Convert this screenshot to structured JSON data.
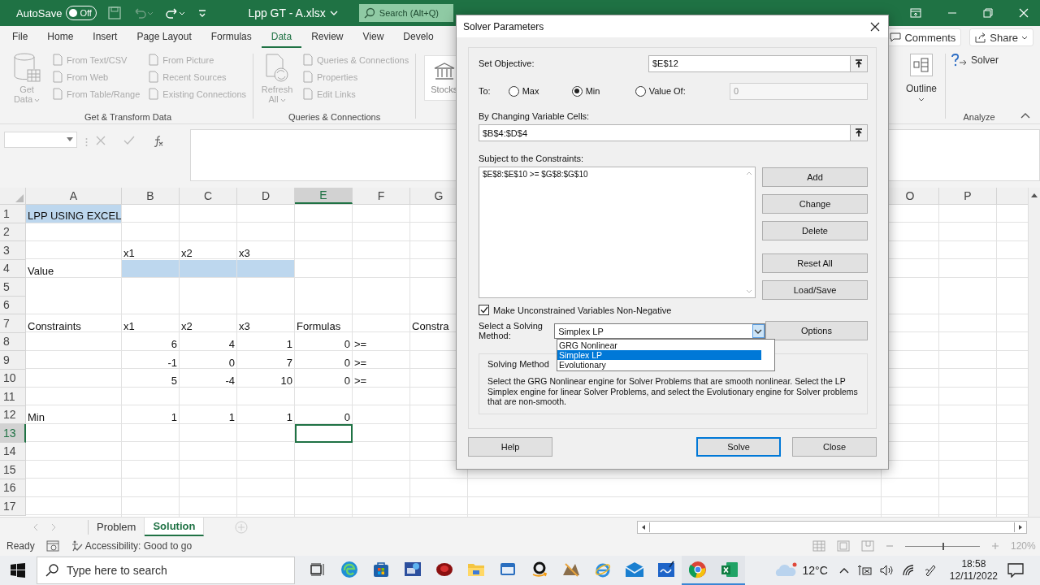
{
  "title_bar": {
    "autosave": {
      "label": "AutoSave",
      "state": "Off",
      "on": false
    },
    "document_title": "Lpp GT - A.xlsx",
    "search": {
      "placeholder": "Search (Alt+Q)"
    }
  },
  "ribbon_tabs": [
    {
      "label": "File",
      "selected": false
    },
    {
      "label": "Home",
      "selected": false
    },
    {
      "label": "Insert",
      "selected": false
    },
    {
      "label": "Page Layout",
      "selected": false
    },
    {
      "label": "Formulas",
      "selected": false
    },
    {
      "label": "Data",
      "selected": true
    },
    {
      "label": "Review",
      "selected": false
    },
    {
      "label": "View",
      "selected": false
    },
    {
      "label": "Develo",
      "selected": false
    }
  ],
  "comments_button": "Comments",
  "share_button": "Share",
  "ribbon_groups": [
    {
      "name": "Get & Transform Data",
      "large_button": {
        "label": "Get Data",
        "kind": "database",
        "disabled": true
      },
      "columns": [
        [
          {
            "label": "From Text/CSV",
            "disabled": true
          },
          {
            "label": "From Web",
            "disabled": true
          },
          {
            "label": "From Table/Range",
            "disabled": true
          }
        ],
        [
          {
            "label": "From Picture",
            "disabled": true
          },
          {
            "label": "Recent Sources",
            "disabled": true
          },
          {
            "label": "Existing Connections",
            "disabled": true
          }
        ]
      ]
    },
    {
      "name": "Queries & Connections",
      "large_button": {
        "label": "Refresh All",
        "kind": "refresh",
        "disabled": true
      },
      "columns": [
        [
          {
            "label": "Queries & Connections",
            "disabled": true
          },
          {
            "label": "Properties",
            "disabled": true
          },
          {
            "label": "Edit Links",
            "disabled": true
          }
        ]
      ]
    }
  ],
  "data_types": {
    "label": "Stocks"
  },
  "outline": {
    "label": "Outline"
  },
  "analyze": {
    "name": "Analyze",
    "solver": "Solver"
  },
  "grid": {
    "columns": [
      {
        "label": "A",
        "selected": false
      },
      {
        "label": "B",
        "selected": false
      },
      {
        "label": "C",
        "selected": false
      },
      {
        "label": "D",
        "selected": false
      },
      {
        "label": "E",
        "selected": true
      },
      {
        "label": "F",
        "selected": false
      },
      {
        "label": "G",
        "selected": false
      },
      {
        "label": "O",
        "selected": false
      },
      {
        "label": "P",
        "selected": false
      }
    ],
    "rows": [
      {
        "number": "1",
        "selected": false,
        "cells": [
          {
            "text": "LPP USING EXCEL",
            "highlighted": true
          }
        ]
      },
      {
        "number": "2",
        "selected": false
      },
      {
        "number": "3",
        "selected": false,
        "cells": [
          null,
          {
            "text": "x1"
          },
          {
            "text": "x2"
          },
          {
            "text": "x3"
          }
        ]
      },
      {
        "number": "4",
        "selected": false,
        "cells": [
          {
            "text": "Value"
          },
          {
            "highlighted": true
          },
          {
            "highlighted": true
          },
          {
            "highlighted": true
          }
        ]
      },
      {
        "number": "5",
        "selected": false
      },
      {
        "number": "6",
        "selected": false
      },
      {
        "number": "7",
        "selected": false,
        "cells": [
          {
            "text": "Constraints"
          },
          {
            "text": "x1"
          },
          {
            "text": "x2"
          },
          {
            "text": "x3"
          },
          {
            "text": "Formulas"
          },
          null,
          {
            "text": "Constra"
          }
        ]
      },
      {
        "number": "8",
        "selected": false,
        "cells": [
          null,
          {
            "text": "6",
            "kind": "number"
          },
          {
            "text": "4",
            "kind": "number"
          },
          {
            "text": "1",
            "kind": "number"
          },
          {
            "text": "0",
            "kind": "number"
          },
          {
            "text": ">="
          }
        ]
      },
      {
        "number": "9",
        "selected": false,
        "cells": [
          null,
          {
            "text": "-1",
            "kind": "number"
          },
          {
            "text": "0",
            "kind": "number"
          },
          {
            "text": "7",
            "kind": "number"
          },
          {
            "text": "0",
            "kind": "number"
          },
          {
            "text": ">="
          }
        ]
      },
      {
        "number": "10",
        "selected": false,
        "cells": [
          null,
          {
            "text": "5",
            "kind": "number"
          },
          {
            "text": "-4",
            "kind": "number"
          },
          {
            "text": "10",
            "kind": "number"
          },
          {
            "text": "0",
            "kind": "number"
          },
          {
            "text": ">="
          }
        ]
      },
      {
        "number": "11",
        "selected": false
      },
      {
        "number": "12",
        "selected": false,
        "cells": [
          {
            "text": "Min"
          },
          {
            "text": "1",
            "kind": "number"
          },
          {
            "text": "1",
            "kind": "number"
          },
          {
            "text": "1",
            "kind": "number"
          },
          {
            "text": "0",
            "kind": "number"
          }
        ]
      },
      {
        "number": "13",
        "selected": true,
        "cells": [
          null,
          null,
          null,
          null,
          {
            "selected": true
          }
        ]
      },
      {
        "number": "14",
        "selected": false
      },
      {
        "number": "15",
        "selected": false
      },
      {
        "number": "16",
        "selected": false
      },
      {
        "number": "17",
        "selected": false
      }
    ]
  },
  "sheet_tabs": [
    {
      "label": "Problem",
      "selected": false
    },
    {
      "label": "Solution",
      "selected": true
    }
  ],
  "status_bar": {
    "mode": "Ready",
    "accessibility": "Accessibility: Good to go",
    "zoom": {
      "level": 0.5,
      "reading": "120%"
    }
  },
  "solver_dialog": {
    "title": "Solver Parameters",
    "objective": {
      "label": "Set Objective:",
      "value": "$E$12"
    },
    "to": {
      "label": "To:",
      "options": [
        {
          "label": "Max",
          "selected": false
        },
        {
          "label": "Min",
          "selected": true
        },
        {
          "label": "Value Of:",
          "selected": false
        }
      ],
      "value_of": {
        "value": "0",
        "disabled": true
      }
    },
    "variable_cells": {
      "label": "By Changing Variable Cells:",
      "value": "$B$4:$D$4"
    },
    "constraints": {
      "label": "Subject to the Constraints:",
      "items": [
        "$E$8:$E$10 >= $G$8:$G$10"
      ]
    },
    "side_buttons": [
      "Add",
      "Change",
      "Delete",
      "Reset All",
      "Load/Save"
    ],
    "non_negative": {
      "label": "Make Unconstrained Variables Non-Negative",
      "checked": true
    },
    "method": {
      "label": "Select a Solving Method:",
      "value": "Simplex LP",
      "expanded": true,
      "options": [
        {
          "label": "GRG Nonlinear",
          "selected": false
        },
        {
          "label": "Simplex LP",
          "selected": true
        },
        {
          "label": "Evolutionary",
          "selected": false
        }
      ]
    },
    "options_button": "Options",
    "method_info": {
      "title": "Solving Method",
      "text": "Select the GRG Nonlinear engine for Solver Problems that are smooth nonlinear. Select the LP Simplex engine for linear Solver Problems, and select the Evolutionary engine for Solver problems that are non-smooth."
    },
    "buttons": [
      {
        "label": "Help",
        "default": false
      },
      {
        "label": "Solve",
        "default": true
      },
      {
        "label": "Close",
        "default": false
      }
    ]
  },
  "taskbar": {
    "search": {
      "placeholder": "Type here to search"
    },
    "apps": [
      {
        "kind": "taskview",
        "running": false
      },
      {
        "kind": "edge",
        "running": false
      },
      {
        "kind": "store",
        "running": false
      },
      {
        "kind": "remote",
        "running": false
      },
      {
        "kind": "red",
        "running": false
      },
      {
        "kind": "folder",
        "running": false
      },
      {
        "kind": "window",
        "running": false
      },
      {
        "kind": "amazon",
        "running": false
      },
      {
        "kind": "game",
        "running": false
      },
      {
        "kind": "ie",
        "running": false
      },
      {
        "kind": "mail",
        "running": false
      },
      {
        "kind": "board",
        "running": false
      },
      {
        "kind": "chrome",
        "running": true
      },
      {
        "kind": "excel",
        "running": true
      }
    ],
    "weather": "12°C",
    "time": "18:58",
    "date": "12/11/2022"
  }
}
